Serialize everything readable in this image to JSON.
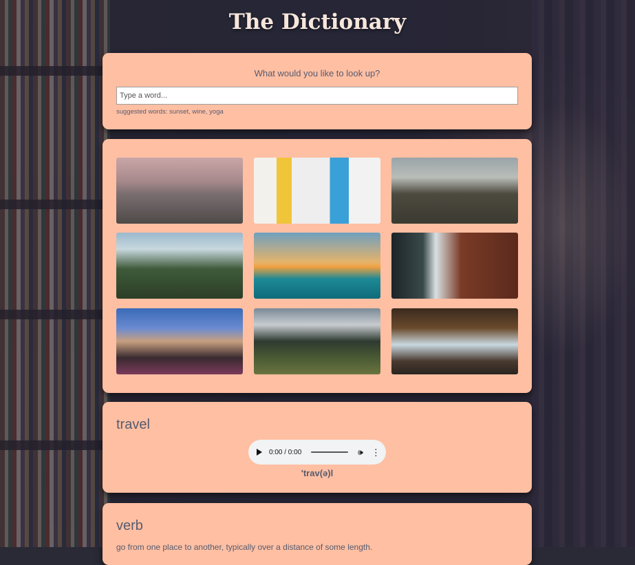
{
  "app": {
    "title": "The Dictionary"
  },
  "search": {
    "prompt": "What would you like to look up?",
    "placeholder": "Type a word...",
    "value": "",
    "suggestions": "suggested words: sunset, wine, yoga"
  },
  "photos": [
    {
      "name": "hot-air-balloons-photo"
    },
    {
      "name": "colorful-street-photo"
    },
    {
      "name": "viaduct-train-photo"
    },
    {
      "name": "mountain-ruins-photo"
    },
    {
      "name": "ocean-sunset-villa-photo"
    },
    {
      "name": "waterfall-cliff-photo"
    },
    {
      "name": "canal-town-photo"
    },
    {
      "name": "alpine-meadow-photo"
    },
    {
      "name": "tent-view-photo"
    }
  ],
  "entry": {
    "word": "travel",
    "audio": {
      "time": "0:00 / 0:00"
    },
    "phonetic": "'trav(ə)l"
  },
  "meaning": {
    "part_of_speech": "verb",
    "definition": "go from one place to another, typically over a distance of some length."
  }
}
